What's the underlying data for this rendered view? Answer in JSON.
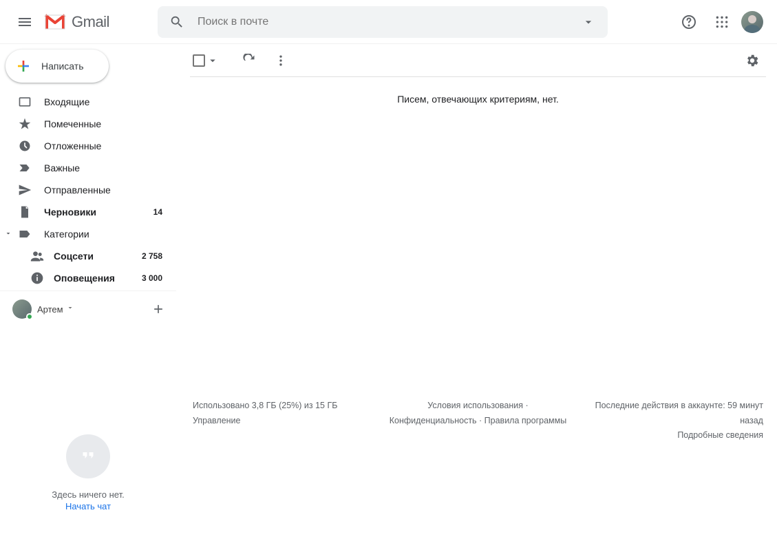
{
  "header": {
    "logo_text": "Gmail",
    "search_placeholder": "Поиск в почте"
  },
  "compose": {
    "label": "Написать"
  },
  "sidebar": {
    "items": [
      {
        "label": "Входящие",
        "count": ""
      },
      {
        "label": "Помеченные",
        "count": ""
      },
      {
        "label": "Отложенные",
        "count": ""
      },
      {
        "label": "Важные",
        "count": ""
      },
      {
        "label": "Отправленные",
        "count": ""
      },
      {
        "label": "Черновики",
        "count": "14"
      },
      {
        "label": "Категории",
        "count": ""
      }
    ],
    "subs": [
      {
        "label": "Соцсети",
        "count": "2 758"
      },
      {
        "label": "Оповещения",
        "count": "3 000"
      }
    ]
  },
  "hangouts": {
    "user": "Артем",
    "empty_text": "Здесь ничего нет.",
    "empty_link": "Начать чат"
  },
  "main": {
    "empty_message": "Писем, отвечающих критериям, нет."
  },
  "footer": {
    "storage_line": "Использовано 3,8 ГБ (25%) из 15 ГБ",
    "storage_manage": "Управление",
    "terms": "Условия использования",
    "privacy": "Конфиденциальность",
    "program": "Правила программы",
    "activity_line": "Последние действия в аккаунте: 59 минут назад",
    "details": "Подробные сведения"
  }
}
